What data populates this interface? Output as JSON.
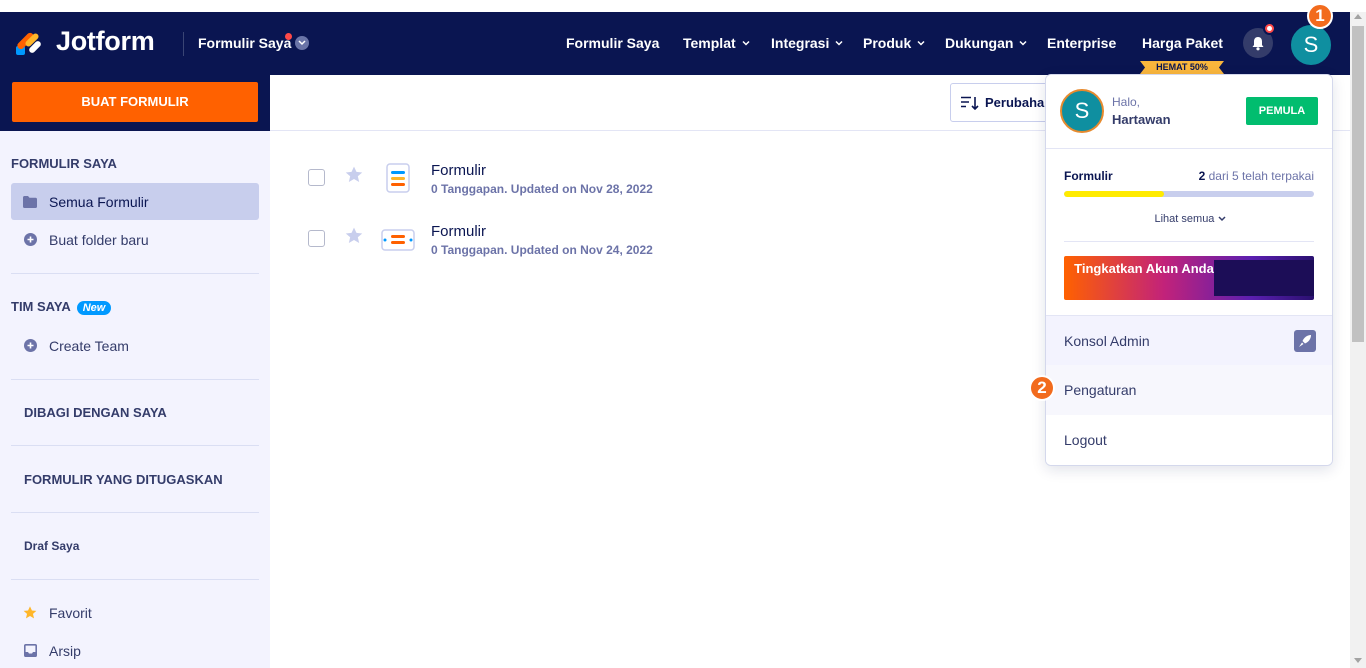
{
  "header": {
    "logo_text": "Jotform",
    "myforms_dropdown": "Formulir Saya",
    "nav": [
      {
        "label": "Formulir Saya",
        "has_caret": false
      },
      {
        "label": "Templat",
        "has_caret": true
      },
      {
        "label": "Integrasi",
        "has_caret": true
      },
      {
        "label": "Produk",
        "has_caret": true
      },
      {
        "label": "Dukungan",
        "has_caret": true
      },
      {
        "label": "Enterprise",
        "has_caret": false
      },
      {
        "label": "Harga Paket",
        "has_caret": false
      }
    ],
    "promo_badge": "HEMAT 50%",
    "avatar_letter": "S",
    "brand_color": "#0a1551",
    "accent_color": "#ff6100"
  },
  "annotations": {
    "step1": "1",
    "step2": "2"
  },
  "sidebar": {
    "create_button": "BUAT FORMULIR",
    "my_forms_title": "FORMULIR SAYA",
    "all_forms": "Semua Formulir",
    "new_folder": "Buat folder baru",
    "team_title": "TIM SAYA",
    "new_badge": "New",
    "create_team": "Create Team",
    "shared_with_me": "DIBAGI DENGAN SAYA",
    "assigned_forms": "FORMULIR YANG DITUGASKAN",
    "drafts": "Draf Saya",
    "favorites": "Favorit",
    "archive": "Arsip"
  },
  "toolbar": {
    "sort_label": "Perubahan"
  },
  "forms": [
    {
      "title": "Formulir",
      "meta": "0 Tanggapan. Updated on Nov 28, 2022",
      "icon": "form-list-icon"
    },
    {
      "title": "Formulir",
      "meta": "0 Tanggapan. Updated on Nov 24, 2022",
      "icon": "form-card-icon"
    }
  ],
  "account_menu": {
    "avatar_letter": "S",
    "greeting": "Halo,",
    "name": "Hartawan",
    "plan_badge": "PEMULA",
    "usage_label": "Formulir",
    "usage_used": "2",
    "usage_text": "dari 5 telah terpakai",
    "usage_fraction": 0.4,
    "see_all": "Lihat semua",
    "upgrade_text": "Tingkatkan Akun Anda",
    "admin_console": "Konsol Admin",
    "settings": "Pengaturan",
    "logout": "Logout"
  }
}
